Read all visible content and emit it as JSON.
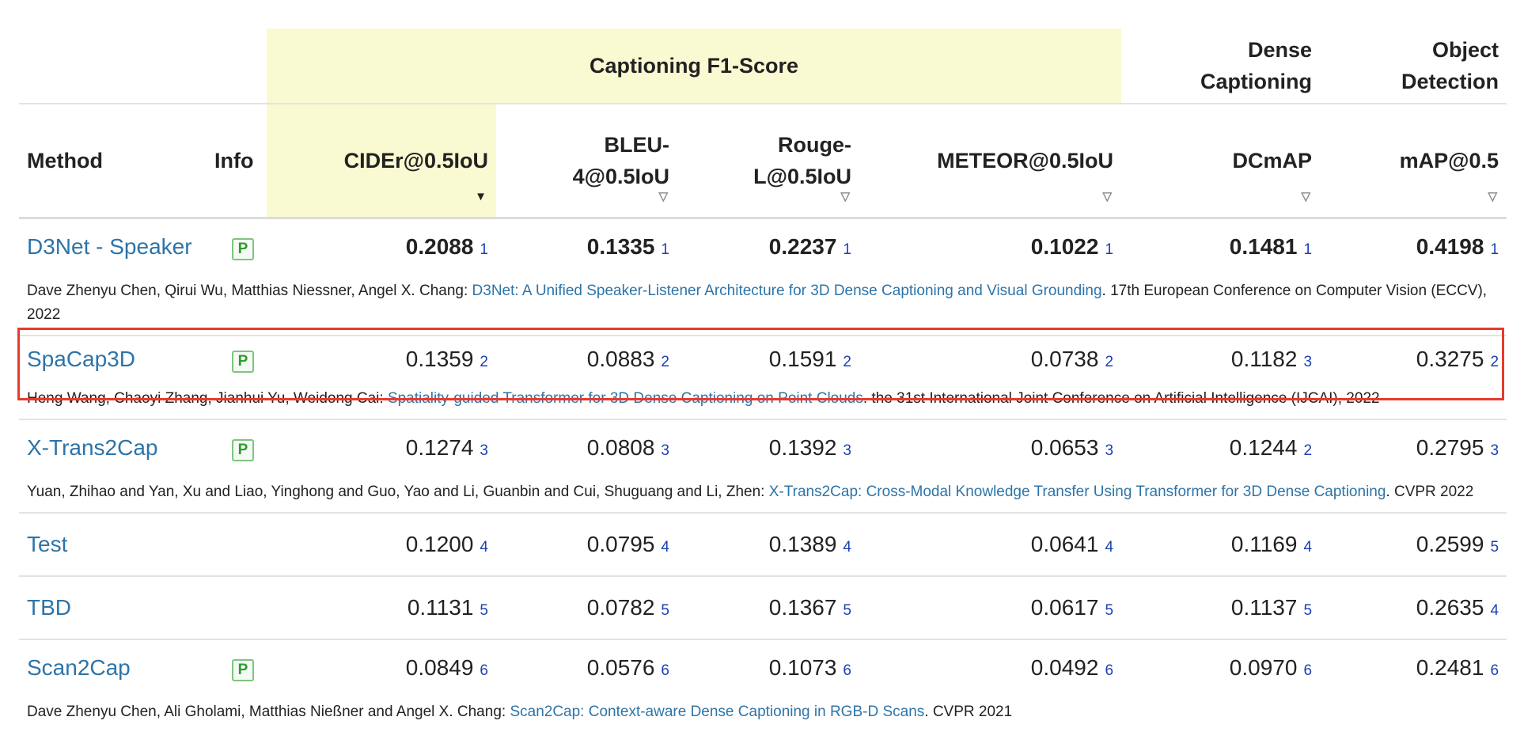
{
  "header": {
    "group_captioning": "Captioning F1-Score",
    "group_dense": [
      "Dense",
      "Captioning"
    ],
    "group_object": [
      "Object",
      "Detection"
    ],
    "columns": {
      "method": "Method",
      "info": "Info",
      "cider": "CIDEr@0.5IoU",
      "bleu": [
        "BLEU-",
        "4@0.5IoU"
      ],
      "rouge": [
        "Rouge-",
        "L@0.5IoU"
      ],
      "meteor": "METEOR@0.5IoU",
      "dcmap": "DCmAP",
      "map": "mAP@0.5"
    },
    "sort_icons": {
      "active": "▼",
      "inactive": "▽"
    }
  },
  "rows": [
    {
      "method": "D3Net - Speaker",
      "info_badge": "P",
      "cider": "0.2088",
      "cider_rank": "1",
      "bleu": "0.1335",
      "bleu_rank": "1",
      "rouge": "0.2237",
      "rouge_rank": "1",
      "meteor": "0.1022",
      "meteor_rank": "1",
      "dcmap": "0.1481",
      "dcmap_rank": "1",
      "map": "0.4198",
      "map_rank": "1",
      "cite_authors": "Dave Zhenyu Chen, Qirui Wu, Matthias Niessner, Angel X. Chang: ",
      "cite_title": "D3Net: A Unified Speaker-Listener Architecture for 3D Dense Captioning and Visual Grounding",
      "cite_venue": ". 17th European Conference on Computer Vision (ECCV), 2022"
    },
    {
      "method": "SpaCap3D",
      "info_badge": "P",
      "cider": "0.1359",
      "cider_rank": "2",
      "bleu": "0.0883",
      "bleu_rank": "2",
      "rouge": "0.1591",
      "rouge_rank": "2",
      "meteor": "0.0738",
      "meteor_rank": "2",
      "dcmap": "0.1182",
      "dcmap_rank": "3",
      "map": "0.3275",
      "map_rank": "2",
      "cite_authors": "Heng Wang, Chaoyi Zhang, Jianhui Yu, Weidong Cai: ",
      "cite_title": "Spatiality-guided Transformer for 3D Dense Captioning on Point Clouds",
      "cite_venue": ". the 31st International Joint Conference on Artificial Intelligence (IJCAI), 2022"
    },
    {
      "method": "X-Trans2Cap",
      "info_badge": "P",
      "cider": "0.1274",
      "cider_rank": "3",
      "bleu": "0.0808",
      "bleu_rank": "3",
      "rouge": "0.1392",
      "rouge_rank": "3",
      "meteor": "0.0653",
      "meteor_rank": "3",
      "dcmap": "0.1244",
      "dcmap_rank": "2",
      "map": "0.2795",
      "map_rank": "3",
      "cite_authors": "Yuan, Zhihao and Yan, Xu and Liao, Yinghong and Guo, Yao and Li, Guanbin and Cui, Shuguang and Li, Zhen: ",
      "cite_title": "X-Trans2Cap: Cross-Modal Knowledge Transfer Using Transformer for 3D Dense Captioning",
      "cite_venue": ". CVPR 2022"
    },
    {
      "method": "Test",
      "cider": "0.1200",
      "cider_rank": "4",
      "bleu": "0.0795",
      "bleu_rank": "4",
      "rouge": "0.1389",
      "rouge_rank": "4",
      "meteor": "0.0641",
      "meteor_rank": "4",
      "dcmap": "0.1169",
      "dcmap_rank": "4",
      "map": "0.2599",
      "map_rank": "5"
    },
    {
      "method": "TBD",
      "cider": "0.1131",
      "cider_rank": "5",
      "bleu": "0.0782",
      "bleu_rank": "5",
      "rouge": "0.1367",
      "rouge_rank": "5",
      "meteor": "0.0617",
      "meteor_rank": "5",
      "dcmap": "0.1137",
      "dcmap_rank": "5",
      "map": "0.2635",
      "map_rank": "4"
    },
    {
      "method": "Scan2Cap",
      "info_badge": "P",
      "cider": "0.0849",
      "cider_rank": "6",
      "bleu": "0.0576",
      "bleu_rank": "6",
      "rouge": "0.1073",
      "rouge_rank": "6",
      "meteor": "0.0492",
      "meteor_rank": "6",
      "dcmap": "0.0970",
      "dcmap_rank": "6",
      "map": "0.2481",
      "map_rank": "6",
      "cite_authors": "Dave Zhenyu Chen, Ali Gholami, Matthias Nießner and Angel X. Chang: ",
      "cite_title": "Scan2Cap: Context-aware Dense Captioning in RGB-D Scans",
      "cite_venue": ". CVPR 2021"
    }
  ],
  "colors": {
    "link": "#2d74a8",
    "rank": "#1a3fb3",
    "highlight_border": "#e83a2e",
    "header_bg": "#fafad2",
    "badge": "#2f9a2f"
  }
}
